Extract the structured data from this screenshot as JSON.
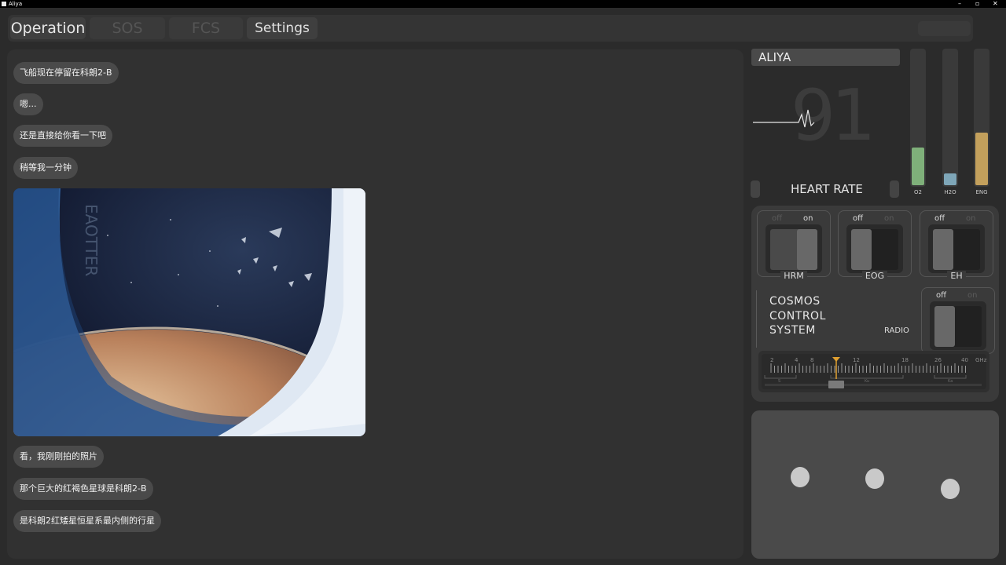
{
  "window": {
    "title": "Aliya",
    "controls": {
      "minimize": "–",
      "maximize": "▫",
      "close": "✕"
    }
  },
  "tabs": [
    {
      "label": "Operation",
      "state": "active"
    },
    {
      "label": "SOS",
      "state": "disabled"
    },
    {
      "label": "FCS",
      "state": "disabled"
    },
    {
      "label": "Settings",
      "state": "normal"
    }
  ],
  "chat": {
    "messages": [
      {
        "text": "飞船现在停留在科朗2-B"
      },
      {
        "text": "嗯..."
      },
      {
        "text": "还是直接给你看一下吧"
      },
      {
        "text": "稍等我一分钟"
      },
      {
        "text": "看，我刚刚拍的照片"
      },
      {
        "text": "那个巨大的红褐色星球是科朗2-B"
      },
      {
        "text": "是科朗2红矮星恒星系最内侧的行星"
      }
    ],
    "photo_overlay_text": "EAOTTER"
  },
  "status": {
    "name": "ALIYA",
    "heart_rate_value": "91",
    "heart_rate_label": "HEART RATE"
  },
  "gauges": [
    {
      "label": "O2",
      "level": 0.28,
      "color": "#7fb07a"
    },
    {
      "label": "H2O",
      "level": 0.09,
      "color": "#7ea6b8"
    },
    {
      "label": "ENG",
      "level": 0.39,
      "color": "#c3a05c"
    }
  ],
  "switches": [
    {
      "label": "HRM",
      "off": "off",
      "on": "on",
      "state": "on"
    },
    {
      "label": "EOG",
      "off": "off",
      "on": "on",
      "state": "off"
    },
    {
      "label": "EH",
      "off": "off",
      "on": "on",
      "state": "off"
    },
    {
      "label": "RADIO",
      "off": "off",
      "on": "on",
      "state": "off"
    }
  ],
  "cosmos": {
    "line1": "COSMOS",
    "line2": "CONTROL",
    "line3": "SYSTEM"
  },
  "tuner": {
    "scale_labels": [
      "2",
      "4",
      "8",
      "12",
      "18",
      "26",
      "40",
      "GHz"
    ],
    "band_labels": [
      "S",
      "Ku",
      "Ka"
    ],
    "pointer_value": 12,
    "pointer_color": "#e0a030"
  },
  "pad": {
    "dots": 3
  }
}
